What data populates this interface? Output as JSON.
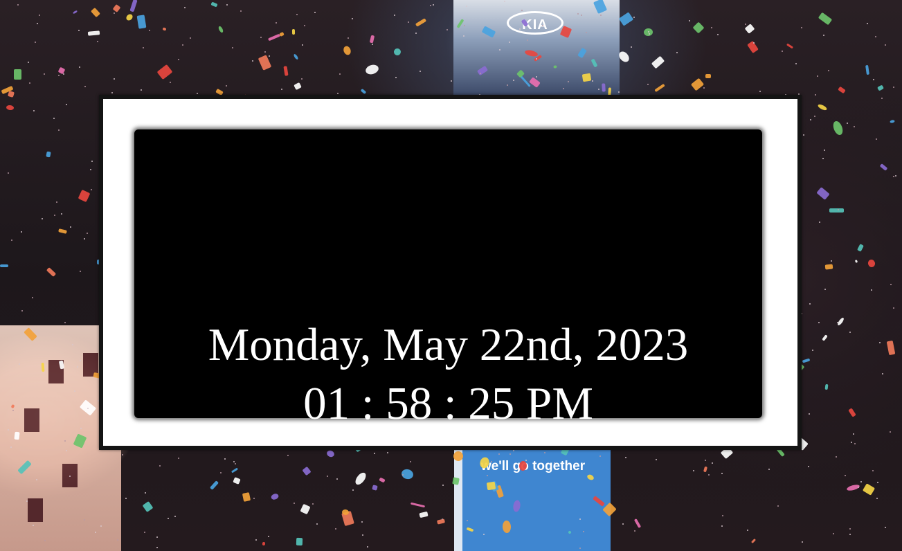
{
  "background": {
    "description_logo": "KIA",
    "billboard_text": "we'll go together",
    "colors": {
      "night_sky": "#1d171b",
      "billboard_blue": "#3f86d0",
      "building_pink": "#e9bfae"
    }
  },
  "clock": {
    "date": "Monday, May 22nd, 2023",
    "time": "01 : 58 : 25 PM",
    "colors": {
      "frame": "#ffffff",
      "frame_border": "#141414",
      "screen": "#000000",
      "text": "#ffffff"
    }
  }
}
